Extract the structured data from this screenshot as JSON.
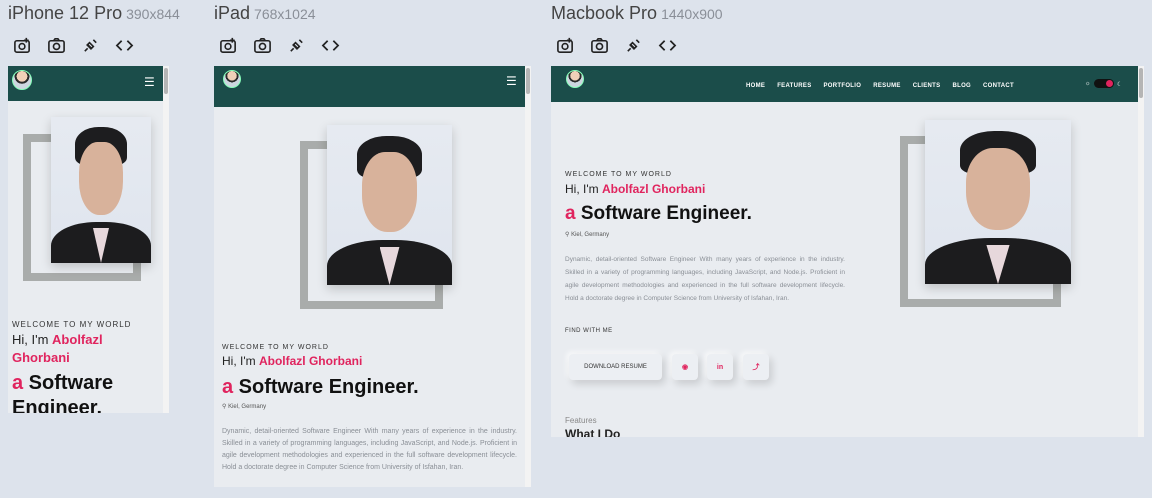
{
  "devices": [
    {
      "name": "iPhone 12 Pro",
      "size": "390x844"
    },
    {
      "name": "iPad",
      "size": "768x1024"
    },
    {
      "name": "Macbook Pro",
      "size": "1440x900"
    }
  ],
  "tools": [
    "camera-settings-icon",
    "camera-icon",
    "plug-icon",
    "code-icon"
  ],
  "site": {
    "welcome": "WELCOME TO MY WORLD",
    "hi_prefix": "Hi, I'm ",
    "name": "Abolfazl Ghorbani",
    "name_line1": "Abolfazl",
    "name_line2": "Ghorbani",
    "role_letter": "a",
    "role": " Software Engineer.",
    "phone_role_line1": " Software",
    "phone_role_line2": "Engineer.",
    "location": "Kiel, Germany",
    "description": "Dynamic, detail-oriented Software Engineer With many years of experience in the industry. Skilled in a variety of programming languages, including JavaScript, and Node.js. Proficient in agile development methodologies and experienced in the full software development lifecycle. Hold a doctorate degree in Computer Science from University of Isfahan, Iran.",
    "menu": [
      "HOME",
      "FEATURES",
      "PORTFOLIO",
      "RESUME",
      "CLIENTS",
      "BLOG",
      "CONTACT"
    ],
    "find_with_me": "FIND WITH ME",
    "download": "DOWNLOAD RESUME",
    "features_label": "Features",
    "what_i_do": "What I Do"
  },
  "colors": {
    "nav": "#1b4d4a",
    "accent": "#e0245e",
    "bg": "#e9ecf0"
  }
}
